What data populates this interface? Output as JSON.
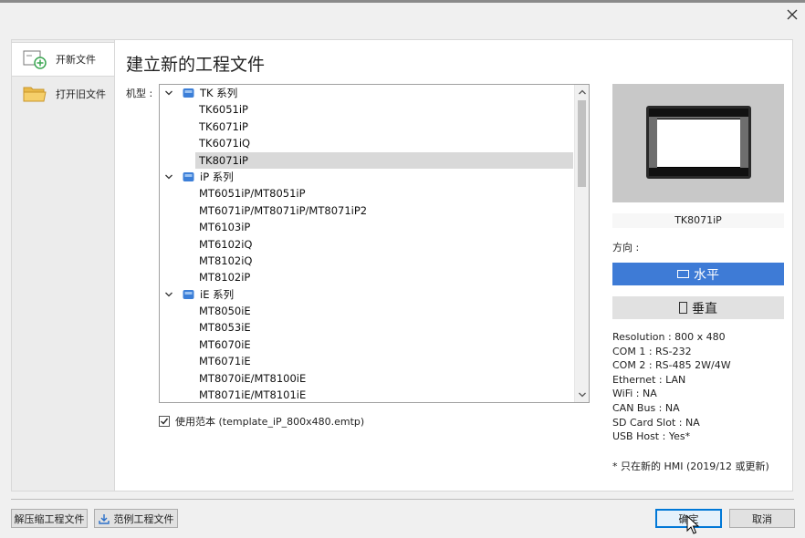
{
  "nav": {
    "items": [
      {
        "label": "开新文件",
        "active": true,
        "icon": "new-file-icon"
      },
      {
        "label": "打开旧文件",
        "active": false,
        "icon": "folder-icon"
      }
    ]
  },
  "main": {
    "title": "建立新的工程文件",
    "model_label": "机型 :",
    "tree": [
      {
        "type": "group",
        "label": "TK 系列"
      },
      {
        "type": "item",
        "label": "TK6051iP"
      },
      {
        "type": "item",
        "label": "TK6071iP"
      },
      {
        "type": "item",
        "label": "TK6071iQ"
      },
      {
        "type": "item",
        "label": "TK8071iP",
        "selected": true
      },
      {
        "type": "group",
        "label": "iP 系列"
      },
      {
        "type": "item",
        "label": "MT6051iP/MT8051iP"
      },
      {
        "type": "item",
        "label": "MT6071iP/MT8071iP/MT8071iP2"
      },
      {
        "type": "item",
        "label": "MT6103iP"
      },
      {
        "type": "item",
        "label": "MT6102iQ"
      },
      {
        "type": "item",
        "label": "MT8102iQ"
      },
      {
        "type": "item",
        "label": "MT8102iP"
      },
      {
        "type": "group",
        "label": "iE 系列"
      },
      {
        "type": "item",
        "label": "MT8050iE"
      },
      {
        "type": "item",
        "label": "MT8053iE"
      },
      {
        "type": "item",
        "label": "MT6070iE"
      },
      {
        "type": "item",
        "label": "MT6071iE"
      },
      {
        "type": "item",
        "label": "MT8070iE/MT8100iE"
      },
      {
        "type": "item",
        "label": "MT8071iE/MT8101iE"
      }
    ],
    "use_template": {
      "checked": true,
      "label": "使用范本 (template_iP_800x480.emtp)"
    }
  },
  "preview": {
    "model_name": "TK8071iP",
    "orientation_label": "方向 :",
    "horizontal_label": "水平",
    "vertical_label": "垂直",
    "selected_orientation": "horizontal",
    "accent_color": "#3e7bd6",
    "specs": [
      "Resolution : 800 x 480",
      "COM 1 : RS-232",
      "COM 2 : RS-485 2W/4W",
      "Ethernet : LAN",
      "WiFi : NA",
      "CAN Bus : NA",
      "SD Card Slot : NA",
      "USB Host : Yes*"
    ],
    "note": "* 只在新的 HMI (2019/12 或更新)"
  },
  "footer": {
    "unzip_label": "解压缩工程文件",
    "samples_label": "范例工程文件",
    "ok_label": "确定",
    "cancel_label": "取消"
  }
}
